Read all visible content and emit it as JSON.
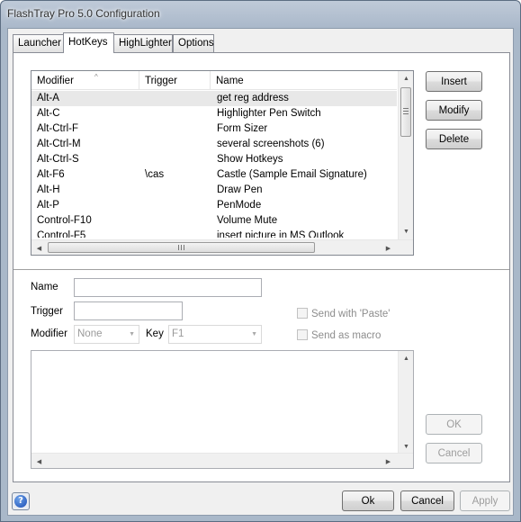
{
  "window": {
    "title": "FlashTray Pro 5.0 Configuration"
  },
  "tabs": [
    {
      "label": "Launcher"
    },
    {
      "label": "HotKeys",
      "active": true
    },
    {
      "label": "HighLighter"
    },
    {
      "label": "Options"
    }
  ],
  "hotkeys": {
    "columns": [
      "Modifier",
      "Trigger",
      "Name"
    ],
    "sort_indicator": "^",
    "rows": [
      {
        "modifier": "Alt-A",
        "trigger": "",
        "name": "get reg address"
      },
      {
        "modifier": "Alt-C",
        "trigger": "",
        "name": "Highlighter Pen Switch"
      },
      {
        "modifier": "Alt-Ctrl-F",
        "trigger": "",
        "name": "Form Sizer"
      },
      {
        "modifier": "Alt-Ctrl-M",
        "trigger": "",
        "name": "several screenshots (6)"
      },
      {
        "modifier": "Alt-Ctrl-S",
        "trigger": "",
        "name": "Show Hotkeys"
      },
      {
        "modifier": "Alt-F6",
        "trigger": "\\cas",
        "name": "Castle (Sample Email Signature)"
      },
      {
        "modifier": "Alt-H",
        "trigger": "",
        "name": "Draw Pen"
      },
      {
        "modifier": "Alt-P",
        "trigger": "",
        "name": "PenMode"
      },
      {
        "modifier": "Control-F10",
        "trigger": "",
        "name": "Volume Mute"
      },
      {
        "modifier": "Control-F5",
        "trigger": "",
        "name": "insert picture in MS Outlook"
      }
    ],
    "selected_row": 0,
    "insert_label": "Insert",
    "modify_label": "Modify",
    "delete_label": "Delete"
  },
  "form": {
    "name_label": "Name",
    "name_value": "",
    "trigger_label": "Trigger",
    "trigger_value": "",
    "modifier_label": "Modifier",
    "modifier_value": "None",
    "key_label": "Key",
    "key_value": "F1",
    "send_with_paste_label": "Send with 'Paste'",
    "send_as_macro_label": "Send as macro",
    "body_text": "",
    "ok_label": "OK",
    "cancel_label": "Cancel"
  },
  "footer": {
    "help_glyph": "?",
    "ok_label": "Ok",
    "cancel_label": "Cancel",
    "apply_label": "Apply"
  },
  "icons": {
    "help": "help-icon",
    "scroll_up": "arrow-up-icon",
    "scroll_down": "arrow-down-icon",
    "scroll_left": "arrow-left-icon",
    "scroll_right": "arrow-right-icon",
    "dropdown": "chevron-down-icon"
  }
}
